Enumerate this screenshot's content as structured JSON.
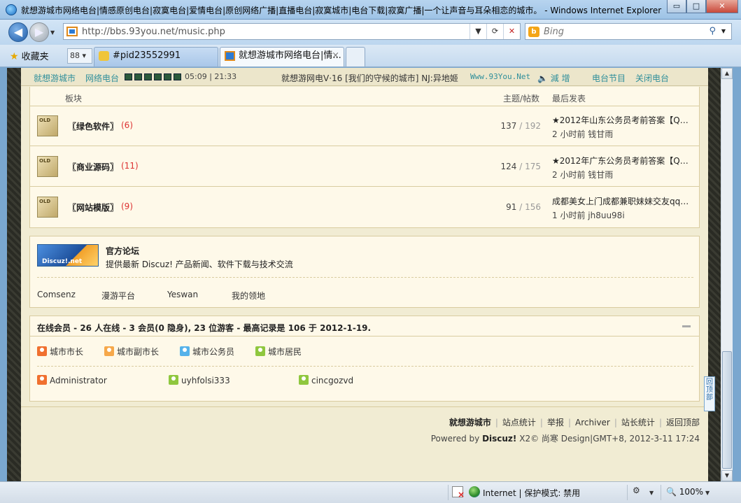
{
  "window": {
    "title": "就想游城市网络电台|情感原创电台|寂寞电台|爱情电台|原创网络广播|直播电台|寂寞城市|电台下载|寂寞广播|一个让声音与耳朵相恋的城市。 - Windows Internet Explorer",
    "minimize": "▭",
    "maximize": "□",
    "close": "✕"
  },
  "address": {
    "url": "http://bbs.93you.net/music.php",
    "search_placeholder": "Bing",
    "search_logo": "b"
  },
  "toolbar": {
    "favorites": "收藏夹",
    "quicktabs_label": "88 ▾"
  },
  "tabs": [
    {
      "label": "#pid23552991"
    },
    {
      "label": "就想游城市网络电台|情...",
      "close": "×"
    }
  ],
  "radio": {
    "site": "就想游城市",
    "station": "网络电台",
    "time": "05:09 | 21:33",
    "now_playing": "就想游网电V·16 [我们的守候的城市] NJ:异地姬",
    "www": "Www.93You.Net",
    "volume": "🔈 減  增",
    "schedule": "电台节目",
    "close": "关闭电台"
  },
  "forum_list": {
    "header": {
      "board": "板块",
      "counts": "主题/帖数",
      "last_post": "最后发表"
    },
    "icon_text": "OLD",
    "rows": [
      {
        "name": "〖绿色软件〗",
        "new_count": "(6)",
        "threads": "137",
        "sep": " / ",
        "posts": "192",
        "last_title": "★2012年山东公务员考前答案【Q…",
        "last_meta": "2 小时前 钱甘雨"
      },
      {
        "name": "〖商业源码〗",
        "new_count": "(11)",
        "threads": "124",
        "sep": " / ",
        "posts": "175",
        "last_title": "★2012年广东公务员考前答案【Q…",
        "last_meta": "2 小时前 钱甘雨"
      },
      {
        "name": "〖网站模版〗",
        "new_count": "(9)",
        "threads": "91",
        "sep": " / ",
        "posts": "156",
        "last_title": "成都美女上门成都兼职妹妹交友qq…",
        "last_meta": "1 小时前 jh8uu98i"
      }
    ]
  },
  "official": {
    "logo_text": "Discuz!.net",
    "title": "官方论坛",
    "description": "提供最新 Discuz! 产品新闻、软件下载与技术交流",
    "links": [
      "Comsenz",
      "漫游平台",
      "Yeswan",
      "我的领地"
    ]
  },
  "online": {
    "summary": "在线会员 - 26 人在线 - 3 会员(0 隐身), 23 位游客 - 最高记录是 106 于 2012-1-19.",
    "legend": [
      "城市市长",
      "城市副市长",
      "城市公务员",
      "城市居民"
    ],
    "users": [
      "Administrator",
      "uyhfolsi333",
      "cincgozvd"
    ]
  },
  "footer": {
    "links": [
      "就想游城市",
      "站点统计",
      "举报",
      "Archiver",
      "站长统计",
      "返回顶部"
    ],
    "separator": "|",
    "powered_prefix": "Powered by ",
    "powered_brand": "Discuz!",
    "powered_suffix": " X2© 尚寒 Design",
    "gmt": "GMT+8, 2012-3-11 17:24"
  },
  "back_to_top": "回顶部",
  "status": {
    "zone": "Internet | 保护模式: 禁用",
    "zoom": "100%"
  },
  "colors": {
    "page_bg": "#f1ecd3",
    "box_bg": "#fef9e9",
    "accent_teal": "#2f8f9b",
    "new_count_red": "#dd3333"
  }
}
